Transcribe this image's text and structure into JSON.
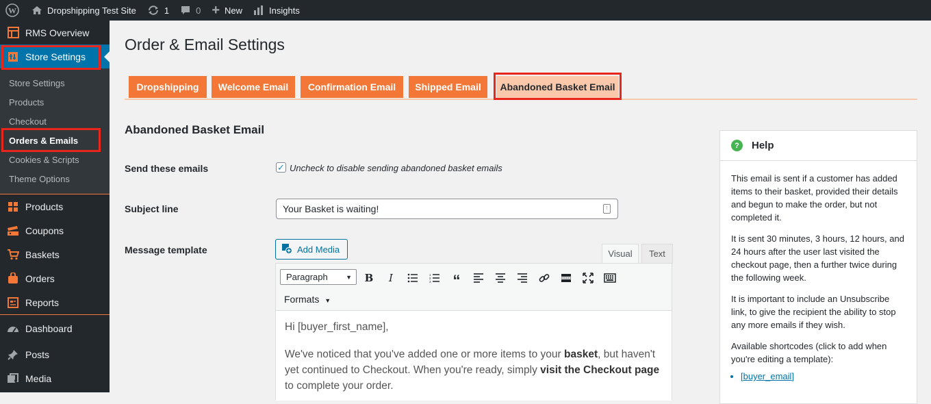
{
  "adminbar": {
    "site_name": "Dropshipping Test Site",
    "updates_count": "1",
    "comments_count": "0",
    "new_label": "New",
    "insights_label": "Insights"
  },
  "sidebar": {
    "top_items": [
      {
        "label": "RMS Overview",
        "icon": "grid-icon"
      },
      {
        "label": "Store Settings",
        "icon": "store-settings-icon"
      }
    ],
    "submenu": [
      "Store Settings",
      "Products",
      "Checkout",
      "Orders & Emails",
      "Cookies & Scripts",
      "Theme Options"
    ],
    "store_items": [
      {
        "label": "Products",
        "icon": "products-icon"
      },
      {
        "label": "Coupons",
        "icon": "coupons-icon"
      },
      {
        "label": "Baskets",
        "icon": "cart-icon"
      },
      {
        "label": "Orders",
        "icon": "orders-icon"
      },
      {
        "label": "Reports",
        "icon": "reports-icon"
      }
    ],
    "wp_items": [
      {
        "label": "Dashboard",
        "icon": "dashboard-icon"
      },
      {
        "label": "Posts",
        "icon": "pin-icon"
      },
      {
        "label": "Media",
        "icon": "media-icon"
      }
    ]
  },
  "page": {
    "title": "Order & Email Settings",
    "tabs": [
      "Dropshipping",
      "Welcome Email",
      "Confirmation Email",
      "Shipped Email",
      "Abandoned Basket Email"
    ],
    "active_tab": "Abandoned Basket Email",
    "section_title": "Abandoned Basket Email"
  },
  "form": {
    "send_label": "Send these emails",
    "send_checked": true,
    "send_description": "Uncheck to disable sending abandoned basket emails",
    "subject_label": "Subject line",
    "subject_value": "Your Basket is waiting!",
    "message_label": "Message template",
    "add_media_label": "Add Media",
    "editor_tabs": [
      "Visual",
      "Text"
    ],
    "paragraph_select": "Paragraph",
    "formats_label": "Formats",
    "content": {
      "line1": "Hi [buyer_first_name],",
      "p2_a": "We've noticed that you've added one or more items to your ",
      "p2_b": "basket",
      "p2_c": ", but haven't yet continued to Checkout. When you're ready, simply ",
      "p2_d": "visit the Checkout page",
      "p2_e": " to complete your order."
    }
  },
  "help": {
    "title": "Help",
    "p1": "This email is sent if a customer has added items to their basket, provided their details and begun to make the order, but not completed it.",
    "p2": "It is sent 30 minutes, 3 hours, 12 hours, and 24 hours after the user last visited the checkout page, then a further twice during the following week.",
    "p3": "It is important to include an Unsubscribe link, to give the recipient the ability to stop any more emails if they wish.",
    "p4": "Available shortcodes (click to add when you're editing a template):",
    "shortcodes": [
      "[buyer_email]"
    ]
  },
  "colors": {
    "accent_orange": "#f37736",
    "active_tab": "#fbc8ab",
    "highlight_red": "#e8261c",
    "wp_blue": "#0073aa",
    "admin_dark": "#23282d"
  }
}
